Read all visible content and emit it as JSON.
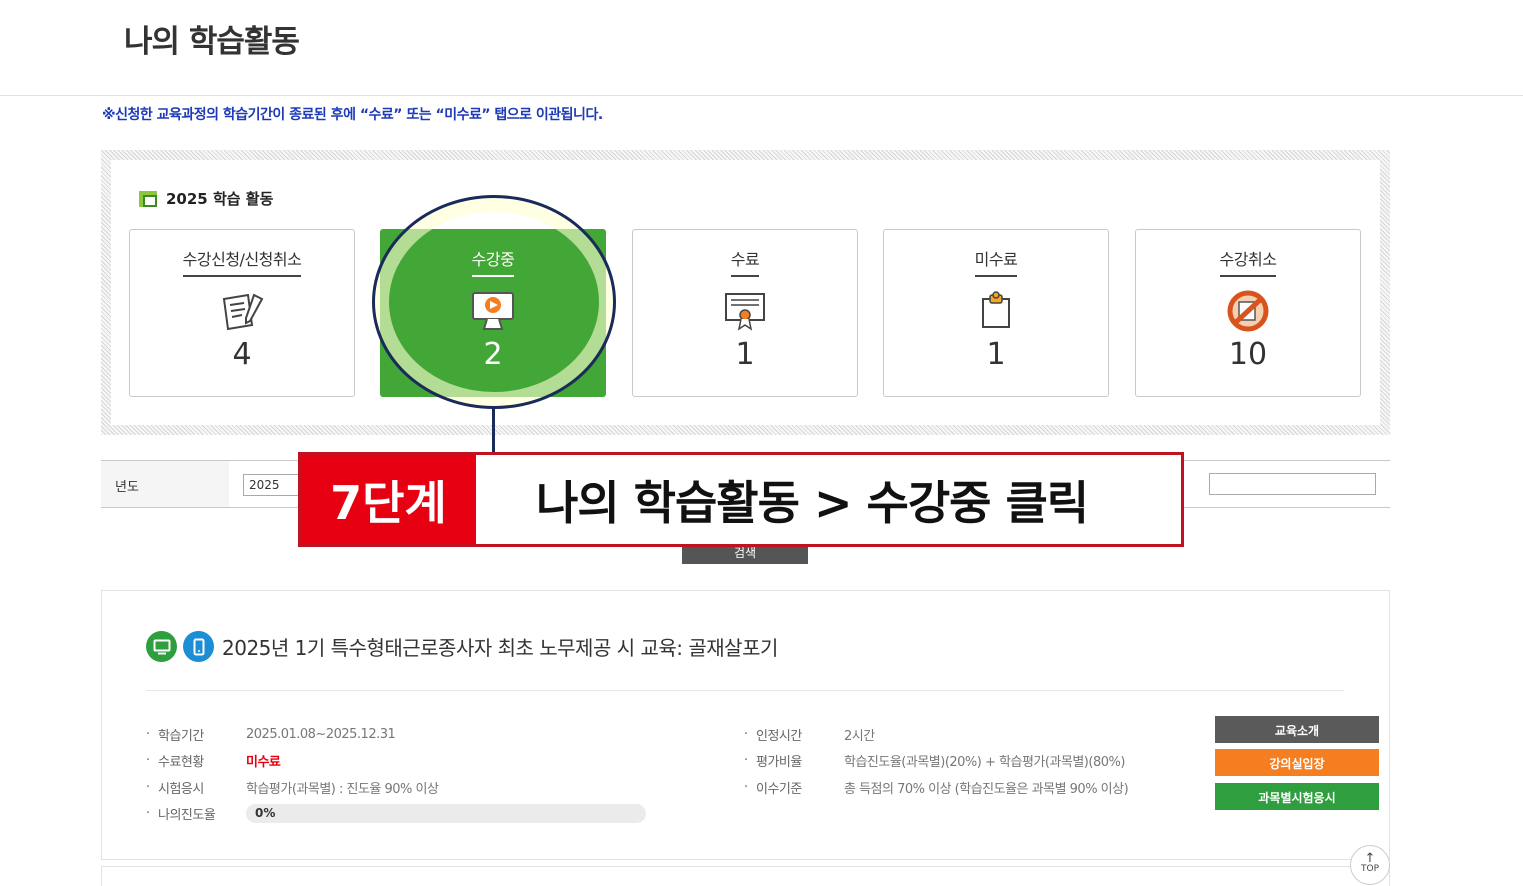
{
  "header": {
    "title": "나의 학습활동"
  },
  "notice": "※신청한 교육과정의 학습기간이 종료된 후에 “수료” 또는 “미수료” 탭으로 이관됩니다.",
  "activity": {
    "title": "2025 학습 활동",
    "cards": [
      {
        "label": "수강신청/신청취소",
        "count": "4",
        "icon": "document-pen-icon",
        "active": false
      },
      {
        "label": "수강중",
        "count": "2",
        "icon": "monitor-play-icon",
        "active": true
      },
      {
        "label": "수료",
        "count": "1",
        "icon": "certificate-icon",
        "active": false
      },
      {
        "label": "미수료",
        "count": "1",
        "icon": "clipboard-icon",
        "active": false
      },
      {
        "label": "수강취소",
        "count": "10",
        "icon": "cancel-prohibited-icon",
        "active": false
      }
    ]
  },
  "filter": {
    "year_label": "년도",
    "year_value": "2025",
    "search_label": "검색"
  },
  "callout": {
    "step": "7단계",
    "text": "나의 학습활동 > 수강중 클릭"
  },
  "course": {
    "title": "2025년 1기 특수형태근로종사자 최초 노무제공 시 교육: 골재살포기",
    "left": [
      {
        "k": "학습기간",
        "v": "2025.01.08~2025.12.31"
      },
      {
        "k": "수료현황",
        "v": "미수료"
      },
      {
        "k": "시험응시",
        "v": "학습평가(과목별) : 진도율 90% 이상"
      },
      {
        "k": "나의진도율",
        "v": "0%"
      }
    ],
    "right": [
      {
        "k": "인정시간",
        "v": "2시간"
      },
      {
        "k": "평가비율",
        "v": "학습진도율(과목별)(20%) + 학습평가(과목별)(80%)"
      },
      {
        "k": "이수기준",
        "v": "총 득점의 70% 이상 (학습진도율은 과목별 90% 이상)"
      }
    ],
    "progress_value": 0,
    "buttons": {
      "intro": "교육소개",
      "enter": "강의실입장",
      "exam": "과목별시험응시"
    }
  },
  "top_button": "TOP",
  "colors": {
    "active_green": "#43a737",
    "callout_red": "#e60012",
    "notice_blue": "#1d3bb8",
    "enter_orange": "#f57e20"
  }
}
